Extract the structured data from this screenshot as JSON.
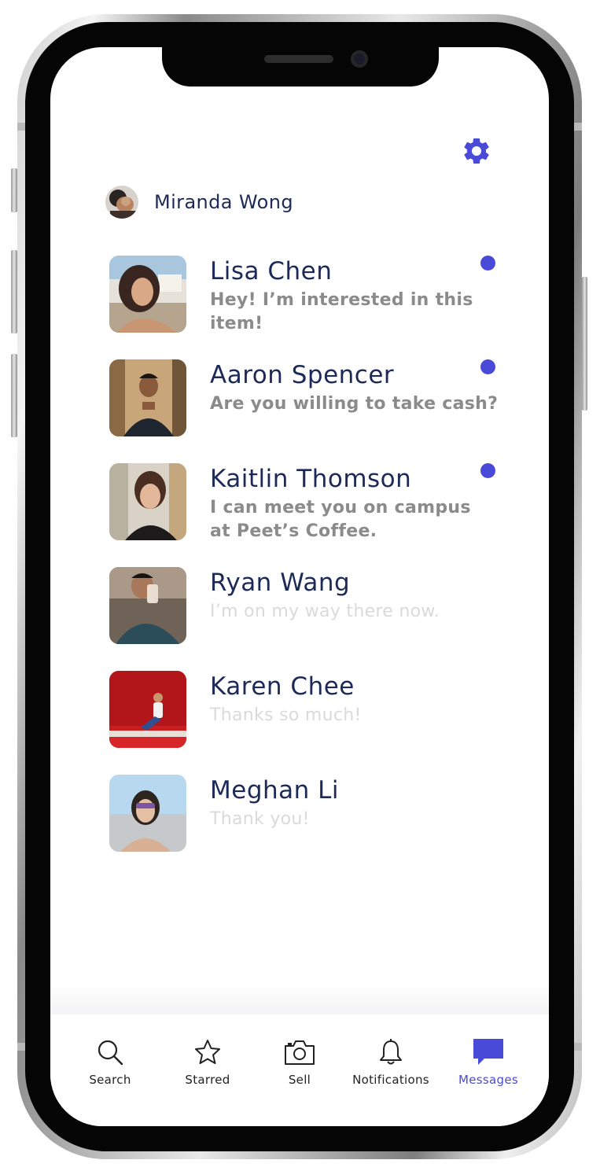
{
  "colors": {
    "accent": "#4a4ad8",
    "name_text": "#1d2a57",
    "unread_text": "#8b8b8b",
    "read_text": "#dadada"
  },
  "settings_icon": "gear-icon",
  "user": {
    "name": "Miranda Wong"
  },
  "conversations": [
    {
      "name": "Lisa Chen",
      "message": "Hey! I’m interested in this item!",
      "unread": true
    },
    {
      "name": "Aaron Spencer",
      "message": "Are you willing to take cash?",
      "unread": true
    },
    {
      "name": "Kaitlin Thomson",
      "message": "I can meet you on campus at Peet’s Coffee.",
      "unread": true
    },
    {
      "name": "Ryan Wang",
      "message": "I’m on my way there now.",
      "unread": false
    },
    {
      "name": "Karen Chee",
      "message": "Thanks so much!",
      "unread": false
    },
    {
      "name": "Meghan Li",
      "message": "Thank you!",
      "unread": false
    }
  ],
  "tabs": [
    {
      "label": "Search",
      "icon": "search-icon"
    },
    {
      "label": "Starred",
      "icon": "star-icon"
    },
    {
      "label": "Sell",
      "icon": "camera-icon"
    },
    {
      "label": "Notifications",
      "icon": "bell-icon"
    },
    {
      "label": "Messages",
      "icon": "message-icon",
      "active": true
    }
  ]
}
